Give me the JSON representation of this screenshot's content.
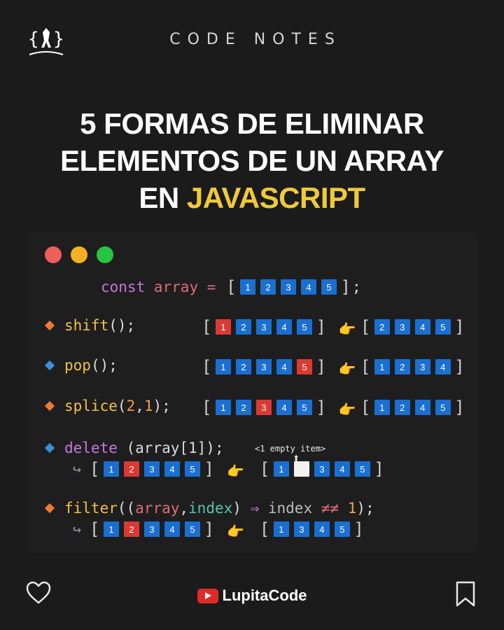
{
  "brand": "CODE NOTES",
  "title": {
    "line1": "5 FORMAS DE ELIMINAR",
    "line2": "ELEMENTOS DE UN ARRAY",
    "line3_prefix": "EN",
    "line3_highlight": "JAVASCRIPT"
  },
  "colors": {
    "background": "#1b1b1c",
    "highlight": "#f0c93a",
    "cell_blue": "#1a6fd1",
    "cell_red": "#d93a33",
    "dot_red": "#ec5f5a",
    "dot_yellow": "#f4b125",
    "dot_green": "#27c440"
  },
  "window_dots": [
    "red-dot",
    "yellow-dot",
    "green-dot"
  ],
  "declaration": {
    "keyword": "const",
    "name": "array",
    "op": "=",
    "end": ";",
    "values": [
      "1",
      "2",
      "3",
      "4",
      "5"
    ]
  },
  "methods": {
    "shift": {
      "name": "shift",
      "args": "();",
      "before": [
        "1",
        "2",
        "3",
        "4",
        "5"
      ],
      "removed": [
        0
      ],
      "after": [
        "2",
        "3",
        "4",
        "5"
      ]
    },
    "pop": {
      "name": "pop",
      "args": "();",
      "before": [
        "1",
        "2",
        "3",
        "4",
        "5"
      ],
      "removed": [
        4
      ],
      "after": [
        "1",
        "2",
        "3",
        "4"
      ]
    },
    "splice": {
      "name": "splice",
      "open": "(",
      "a1": "2",
      "comma": ", ",
      "a2": "1",
      "close": ");",
      "before": [
        "1",
        "2",
        "3",
        "4",
        "5"
      ],
      "removed": [
        2
      ],
      "after": [
        "1",
        "2",
        "4",
        "5"
      ]
    },
    "delete": {
      "keyword": "delete",
      "expr": "(array[1]);",
      "note": "<1 empty item>",
      "before": [
        "1",
        "2",
        "3",
        "4",
        "5"
      ],
      "removed": [
        1
      ],
      "after": [
        "1",
        "",
        "3",
        "4",
        "5"
      ]
    },
    "filter": {
      "name": "filter",
      "open": "((",
      "p1": "array",
      "comma": ", ",
      "p2": "index",
      "close": ")",
      "arrow": "⇒",
      "body": "index",
      "neq": "≠≠",
      "val": "1",
      "end": ");",
      "before": [
        "1",
        "2",
        "3",
        "4",
        "5"
      ],
      "removed": [
        1
      ],
      "after": [
        "1",
        "3",
        "4",
        "5"
      ]
    }
  },
  "icons": {
    "hand": "pointing-hand-icon",
    "return": "return-arrow-icon",
    "heart": "heart-icon",
    "bookmark": "bookmark-icon",
    "youtube": "youtube-icon"
  },
  "footer": {
    "channel": "LupitaCode"
  }
}
